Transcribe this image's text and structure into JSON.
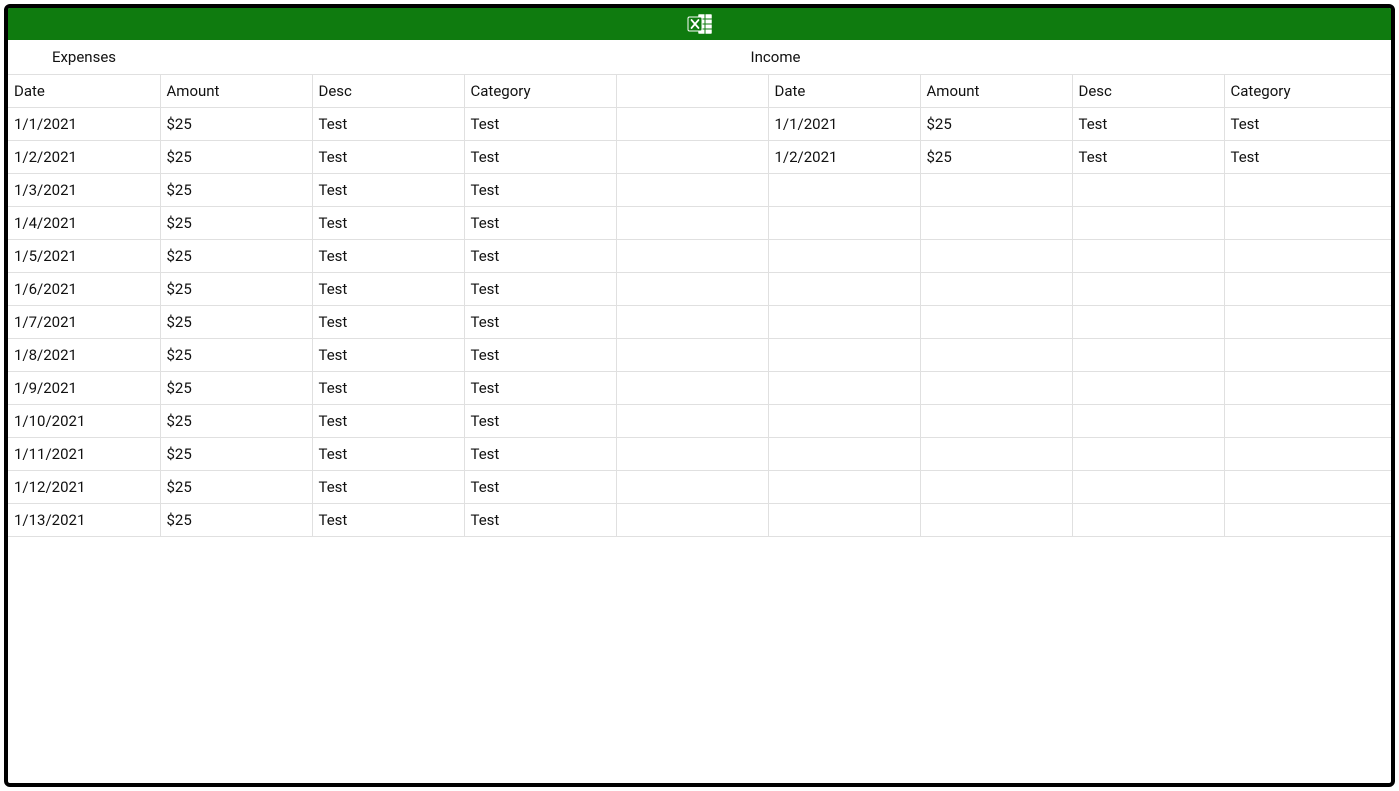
{
  "titlebar": {
    "icon_name": "excel-icon"
  },
  "sections": {
    "left_title": "Expenses",
    "right_title": "Income"
  },
  "headers": {
    "left": {
      "date": "Date",
      "amount": "Amount",
      "desc": "Desc",
      "category": "Category"
    },
    "gap": "",
    "right": {
      "date": "Date",
      "amount": "Amount",
      "desc": "Desc",
      "category": "Category"
    }
  },
  "rows": [
    {
      "l_date": "1/1/2021",
      "l_amount": "$25",
      "l_desc": "Test",
      "l_cat": "Test",
      "r_date": "1/1/2021",
      "r_amount": "$25",
      "r_desc": "Test",
      "r_cat": "Test"
    },
    {
      "l_date": "1/2/2021",
      "l_amount": "$25",
      "l_desc": "Test",
      "l_cat": "Test",
      "r_date": "1/2/2021",
      "r_amount": "$25",
      "r_desc": "Test",
      "r_cat": "Test"
    },
    {
      "l_date": "1/3/2021",
      "l_amount": "$25",
      "l_desc": "Test",
      "l_cat": "Test",
      "r_date": "",
      "r_amount": "",
      "r_desc": "",
      "r_cat": ""
    },
    {
      "l_date": "1/4/2021",
      "l_amount": "$25",
      "l_desc": "Test",
      "l_cat": "Test",
      "r_date": "",
      "r_amount": "",
      "r_desc": "",
      "r_cat": ""
    },
    {
      "l_date": "1/5/2021",
      "l_amount": "$25",
      "l_desc": "Test",
      "l_cat": "Test",
      "r_date": "",
      "r_amount": "",
      "r_desc": "",
      "r_cat": ""
    },
    {
      "l_date": "1/6/2021",
      "l_amount": "$25",
      "l_desc": "Test",
      "l_cat": "Test",
      "r_date": "",
      "r_amount": "",
      "r_desc": "",
      "r_cat": ""
    },
    {
      "l_date": "1/7/2021",
      "l_amount": "$25",
      "l_desc": "Test",
      "l_cat": "Test",
      "r_date": "",
      "r_amount": "",
      "r_desc": "",
      "r_cat": ""
    },
    {
      "l_date": "1/8/2021",
      "l_amount": "$25",
      "l_desc": "Test",
      "l_cat": "Test",
      "r_date": "",
      "r_amount": "",
      "r_desc": "",
      "r_cat": ""
    },
    {
      "l_date": "1/9/2021",
      "l_amount": "$25",
      "l_desc": "Test",
      "l_cat": "Test",
      "r_date": "",
      "r_amount": "",
      "r_desc": "",
      "r_cat": ""
    },
    {
      "l_date": "1/10/2021",
      "l_amount": "$25",
      "l_desc": "Test",
      "l_cat": "Test",
      "r_date": "",
      "r_amount": "",
      "r_desc": "",
      "r_cat": ""
    },
    {
      "l_date": "1/11/2021",
      "l_amount": "$25",
      "l_desc": "Test",
      "l_cat": "Test",
      "r_date": "",
      "r_amount": "",
      "r_desc": "",
      "r_cat": ""
    },
    {
      "l_date": "1/12/2021",
      "l_amount": "$25",
      "l_desc": "Test",
      "l_cat": "Test",
      "r_date": "",
      "r_amount": "",
      "r_desc": "",
      "r_cat": ""
    },
    {
      "l_date": "1/13/2021",
      "l_amount": "$25",
      "l_desc": "Test",
      "l_cat": "Test",
      "r_date": "",
      "r_amount": "",
      "r_desc": "",
      "r_cat": ""
    }
  ]
}
